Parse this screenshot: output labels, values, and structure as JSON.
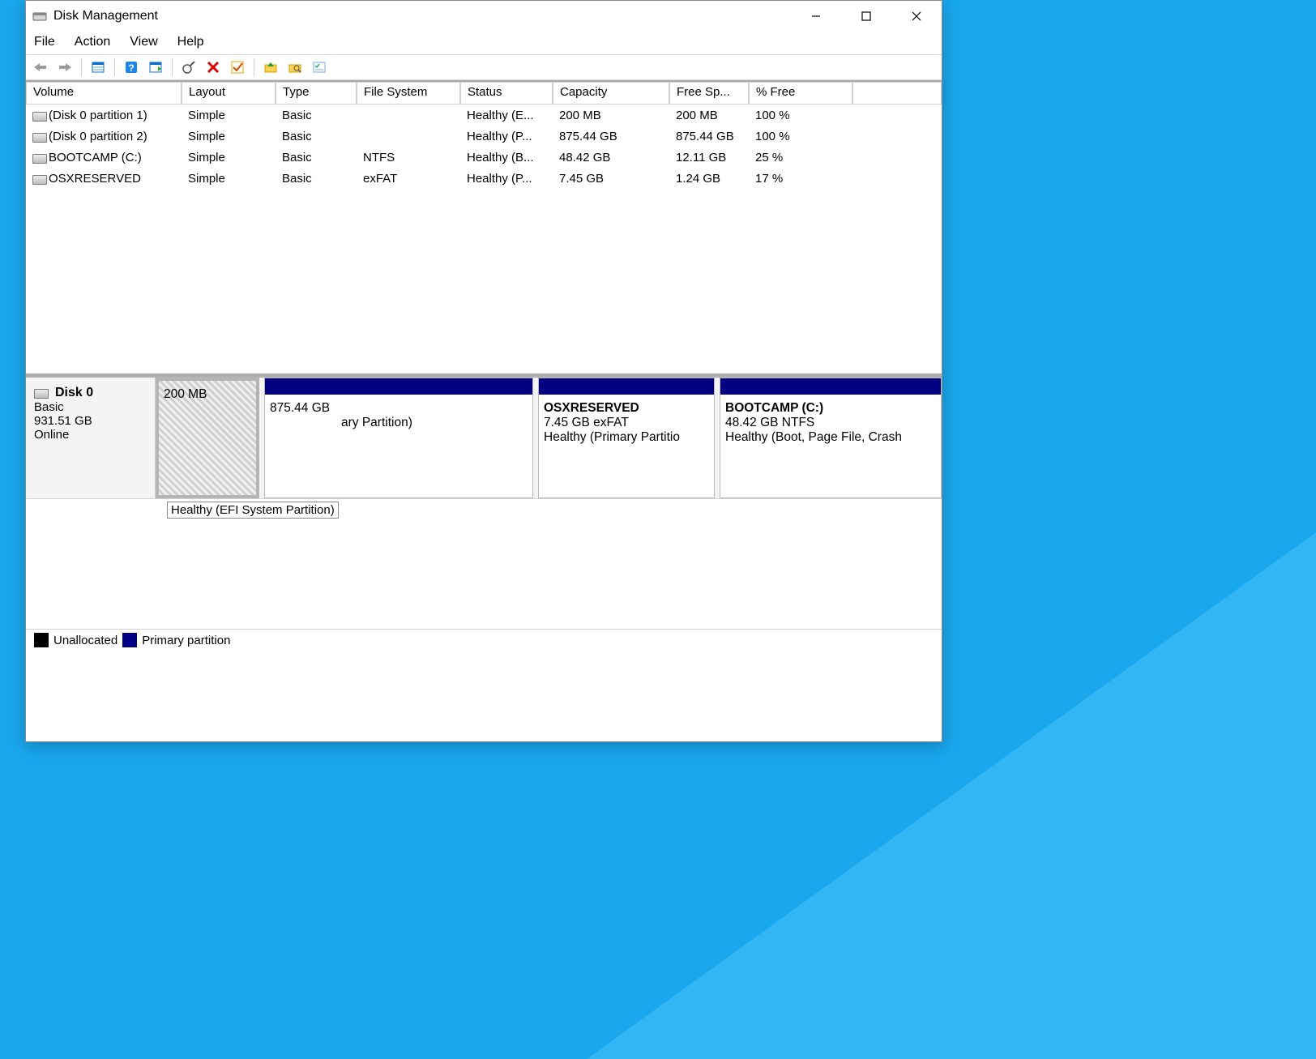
{
  "window": {
    "title": "Disk Management"
  },
  "menu": {
    "file": "File",
    "action": "Action",
    "view": "View",
    "help": "Help"
  },
  "columns": {
    "volume": "Volume",
    "layout": "Layout",
    "type": "Type",
    "filesystem": "File System",
    "status": "Status",
    "capacity": "Capacity",
    "freespace": "Free Sp...",
    "pctfree": "% Free"
  },
  "volumes": [
    {
      "volume": "(Disk 0 partition 1)",
      "layout": "Simple",
      "type": "Basic",
      "fs": "",
      "status": "Healthy (E...",
      "capacity": "200 MB",
      "free": "200 MB",
      "pct": "100 %"
    },
    {
      "volume": "(Disk 0 partition 2)",
      "layout": "Simple",
      "type": "Basic",
      "fs": "",
      "status": "Healthy (P...",
      "capacity": "875.44 GB",
      "free": "875.44 GB",
      "pct": "100 %"
    },
    {
      "volume": "BOOTCAMP (C:)",
      "layout": "Simple",
      "type": "Basic",
      "fs": "NTFS",
      "status": "Healthy (B...",
      "capacity": "48.42 GB",
      "free": "12.11 GB",
      "pct": "25 %"
    },
    {
      "volume": "OSXRESERVED",
      "layout": "Simple",
      "type": "Basic",
      "fs": "exFAT",
      "status": "Healthy (P...",
      "capacity": "7.45 GB",
      "free": "1.24 GB",
      "pct": "17 %"
    }
  ],
  "disk": {
    "name": "Disk 0",
    "type": "Basic",
    "size": "931.51 GB",
    "state": "Online",
    "partitions": [
      {
        "name": "",
        "size": "200 MB",
        "status": "Healthy (EFI System Partition)"
      },
      {
        "name": "",
        "size": "875.44 GB",
        "status": "ary Partition)"
      },
      {
        "name": "OSXRESERVED",
        "size": "7.45 GB exFAT",
        "status": "Healthy (Primary Partitio"
      },
      {
        "name": "BOOTCAMP  (C:)",
        "size": "48.42 GB NTFS",
        "status": "Healthy (Boot, Page File, Crash"
      }
    ]
  },
  "tooltip": "Healthy (EFI System Partition)",
  "legend": {
    "unallocated": "Unallocated",
    "primary": "Primary partition"
  }
}
